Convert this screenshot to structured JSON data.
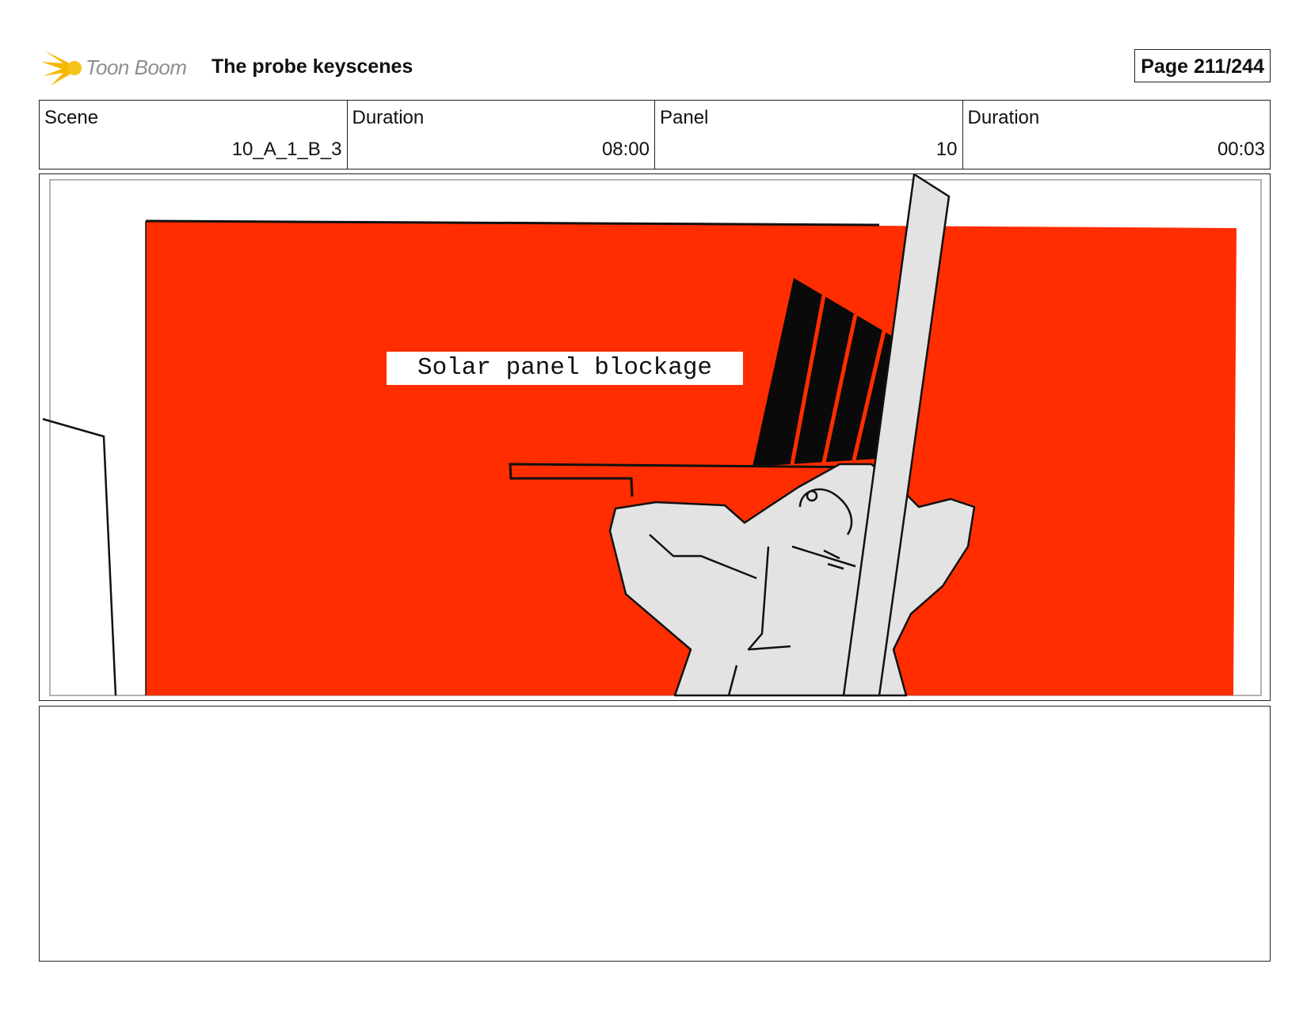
{
  "header": {
    "logo_text": "Toon Boom",
    "title": "The probe keyscenes",
    "page_label": "Page 211/244"
  },
  "info": {
    "scene_label": "Scene",
    "scene_value": "10_A_1_B_3",
    "scene_duration_label": "Duration",
    "scene_duration_value": "08:00",
    "panel_label": "Panel",
    "panel_value": "10",
    "panel_duration_label": "Duration",
    "panel_duration_value": "00:03"
  },
  "panel": {
    "caption": "Solar panel blockage",
    "background_color": "#ff2d00",
    "figure_color": "#e3e3e3"
  },
  "notes": {
    "text": ""
  }
}
